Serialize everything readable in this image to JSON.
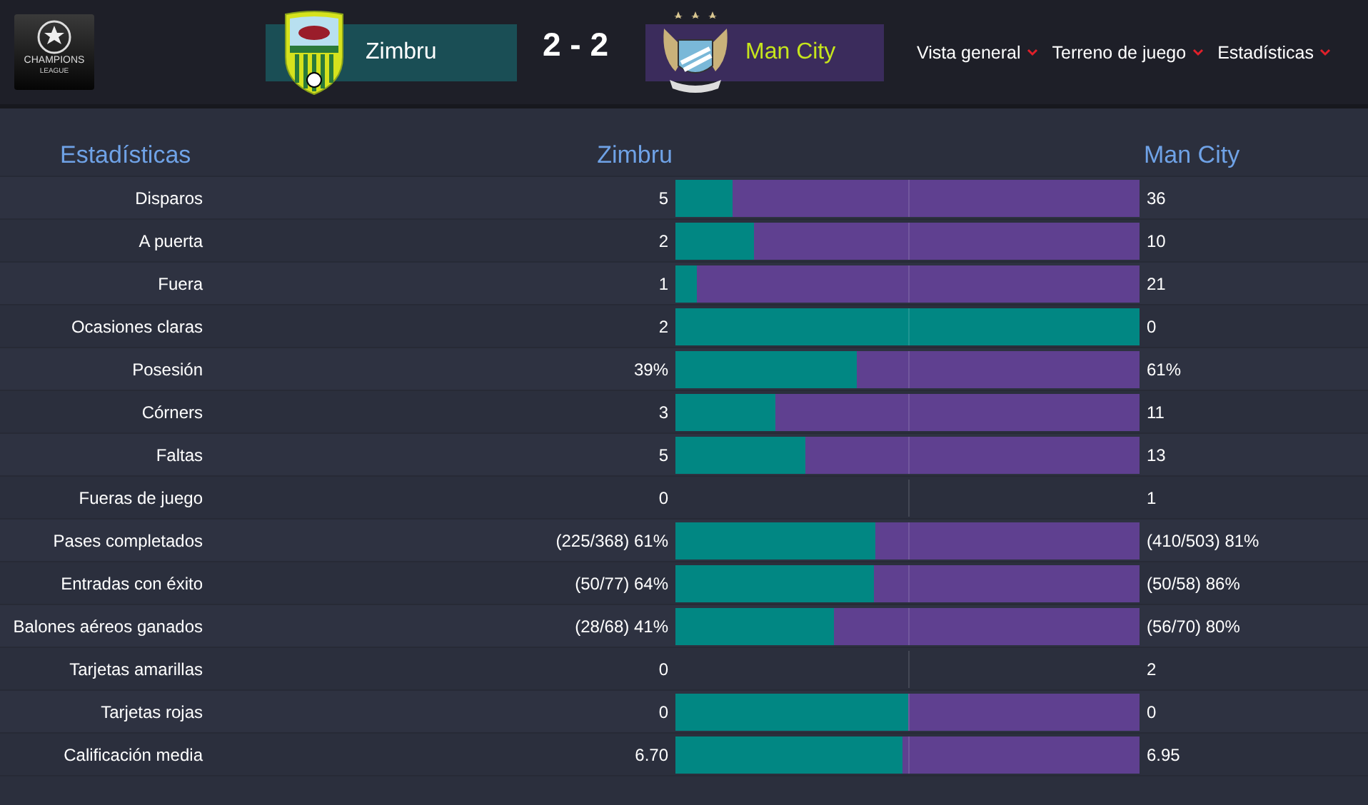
{
  "competition_logo": {
    "line_1": "CHAMPIONS",
    "line_2": "LEAGUE"
  },
  "home": {
    "name": "Zimbru"
  },
  "score": "2 - 2",
  "away": {
    "name": "Man City"
  },
  "nav": [
    {
      "label": "Vista general"
    },
    {
      "label": "Terreno de juego"
    },
    {
      "label": "Estadísticas"
    }
  ],
  "headings": {
    "title": "Estadísticas",
    "home": "Zimbru",
    "away": "Man City"
  },
  "rows": [
    {
      "label": "Disparos",
      "home": "5",
      "away": "36",
      "level": 0.123
    },
    {
      "label": "A puerta",
      "home": "2",
      "away": "10",
      "level": 0.169
    },
    {
      "label": "Fuera",
      "home": "1",
      "away": "21",
      "level": 0.046
    },
    {
      "label": "Ocasiones claras",
      "home": "2",
      "away": "0",
      "level": 1
    },
    {
      "label": "Posesión",
      "home": "39%",
      "away": "61%",
      "level": 0.39
    },
    {
      "label": "Córners",
      "home": "3",
      "away": "11",
      "level": 0.215
    },
    {
      "label": "Faltas",
      "home": "5",
      "away": "13",
      "level": 0.28
    },
    {
      "label": "Fueras de juego",
      "home": "0",
      "away": "1"
    },
    {
      "label": "Pases completados",
      "home": "(225/368) 61%",
      "away": "(410/503) 81%",
      "level": 0.43
    },
    {
      "label": "Entradas con éxito",
      "home": "(50/77) 64%",
      "away": "(50/58) 86%",
      "level": 0.428
    },
    {
      "label": "Balones aéreos ganados",
      "home": "(28/68) 41%",
      "away": "(56/70) 80%",
      "level": 0.34
    },
    {
      "label": "Tarjetas amarillas",
      "home": "0",
      "away": "2"
    },
    {
      "label": "Tarjetas rojas",
      "home": "0",
      "away": "0",
      "level": 0.5
    },
    {
      "label": "Calificación media",
      "home": "6.70",
      "away": "6.95",
      "level": 0.49
    }
  ]
}
